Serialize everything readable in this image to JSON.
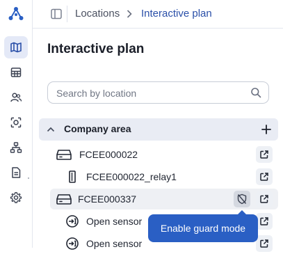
{
  "nav": {
    "items": [
      {
        "name": "map-icon",
        "active": true
      },
      {
        "name": "grid-icon",
        "active": false
      },
      {
        "name": "users-icon",
        "active": false
      },
      {
        "name": "camera-focus-icon",
        "active": false
      },
      {
        "name": "hierarchy-icon",
        "active": false
      },
      {
        "name": "document-icon",
        "active": false
      },
      {
        "name": "gear-icon",
        "active": false
      }
    ]
  },
  "breadcrumb": {
    "items": [
      "Locations",
      "Interactive plan"
    ]
  },
  "page": {
    "title": "Interactive plan"
  },
  "search": {
    "placeholder": "Search by location",
    "value": ""
  },
  "tree": {
    "group": {
      "label": "Company area",
      "expanded": true
    },
    "rows": [
      {
        "label": "FCEE000022",
        "icon": "hub-icon"
      },
      {
        "label": "FCEE000022_relay1",
        "icon": "relay-icon"
      },
      {
        "label": "FCEE000337",
        "icon": "hub-icon"
      },
      {
        "label": "Open sensor",
        "icon": "sensor-icon"
      },
      {
        "label": "Open sensor",
        "icon": "sensor-icon"
      }
    ]
  },
  "tooltip": {
    "text": "Enable guard mode"
  },
  "colors": {
    "accent": "#2a5fc4",
    "nav_active_bg": "#e4e9f7",
    "group_bg": "#e9ecf4",
    "breadcrumb_current": "#2a4fa8"
  }
}
